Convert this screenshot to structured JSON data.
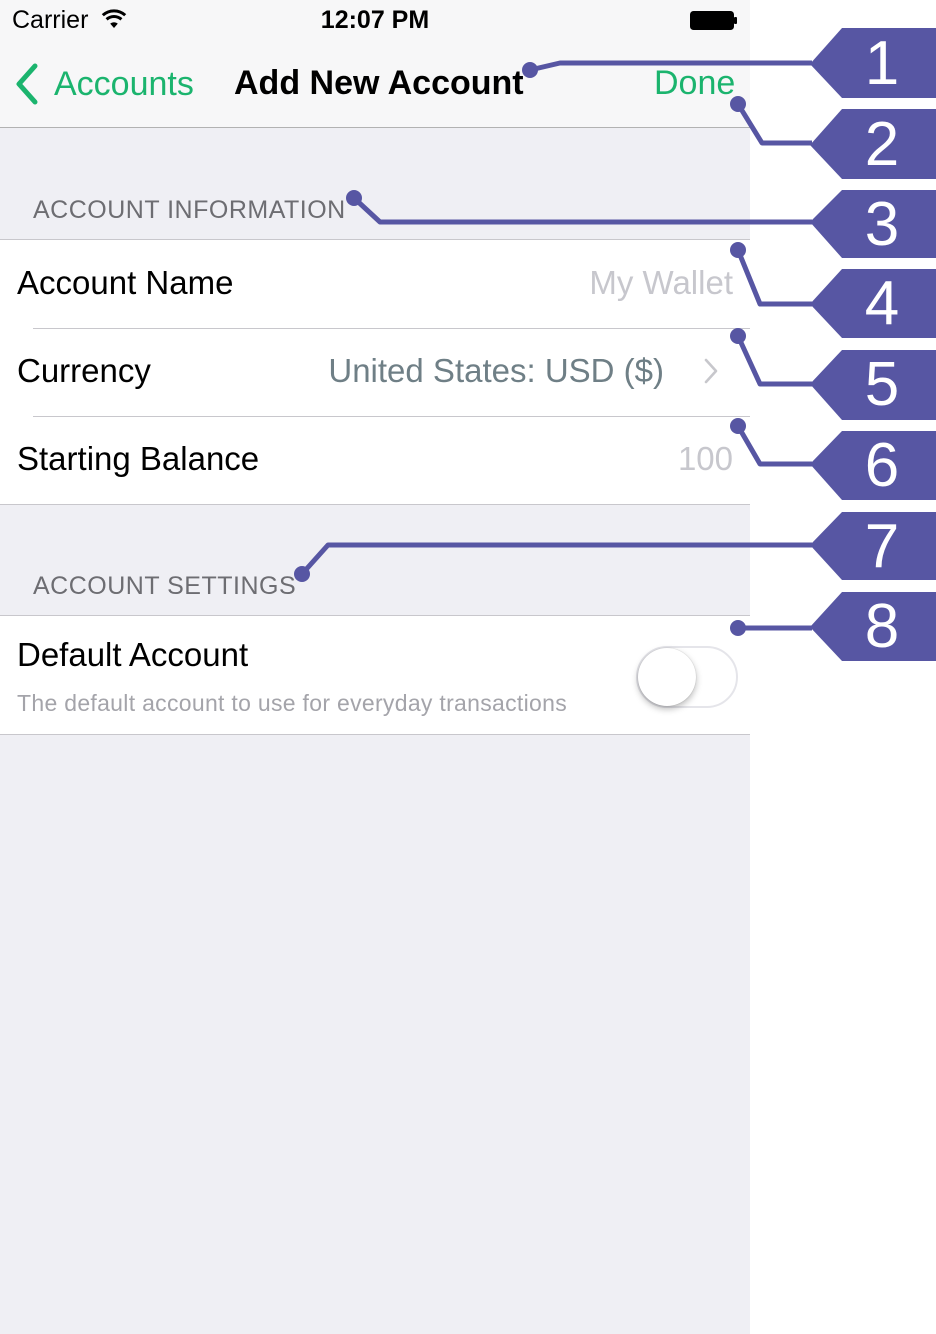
{
  "status_bar": {
    "carrier": "Carrier",
    "time": "12:07 PM"
  },
  "nav_bar": {
    "back_label": "Accounts",
    "title": "Add New Account",
    "done_label": "Done"
  },
  "sections": {
    "account_information": {
      "header": "ACCOUNT INFORMATION",
      "account_name": {
        "label": "Account Name",
        "placeholder": "My Wallet"
      },
      "currency": {
        "label": "Currency",
        "value": "United States: USD ($)"
      },
      "starting_balance": {
        "label": "Starting Balance",
        "placeholder": "100"
      }
    },
    "account_settings": {
      "header": "ACCOUNT SETTINGS",
      "default_account": {
        "label": "Default Account",
        "hint": "The default account to use for everyday transactions",
        "enabled": false
      }
    }
  },
  "callouts": [
    "1",
    "2",
    "3",
    "4",
    "5",
    "6",
    "7",
    "8"
  ],
  "colors": {
    "accent": "#1bb46e",
    "callout": "#5756a3",
    "background": "#efeff4"
  },
  "icons": [
    "wifi-icon",
    "battery-icon",
    "chevron-left-icon",
    "chevron-right-icon"
  ]
}
